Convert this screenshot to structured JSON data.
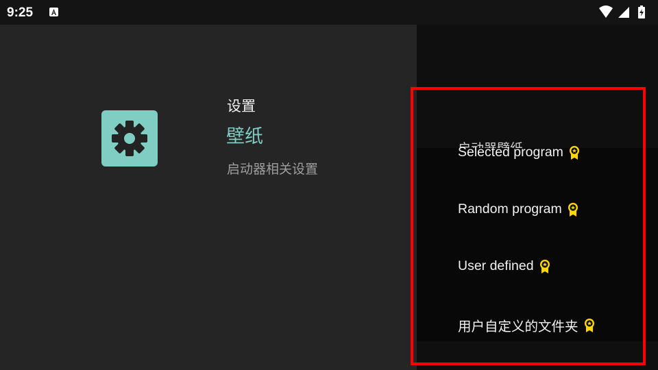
{
  "status_bar": {
    "time": "9:25",
    "notification_icon": "font-a-icon",
    "icons": [
      "wifi-icon",
      "signal-icon",
      "battery-charging-icon"
    ]
  },
  "page": {
    "app_icon": "settings-gear-icon",
    "breadcrumb": "设置",
    "title": "壁纸",
    "description": "启动器相关设置"
  },
  "panel": {
    "title": "启动器壁纸",
    "options": [
      {
        "label": "Selected program",
        "badge": "premium-badge-icon"
      },
      {
        "label": "Random program",
        "badge": "premium-badge-icon"
      },
      {
        "label": "User defined",
        "badge": "premium-badge-icon"
      },
      {
        "label": "用户自定义的文件夹",
        "badge": "premium-badge-icon"
      }
    ]
  },
  "colors": {
    "accent": "#80cbc4",
    "icon_bg": "#7fcdc3",
    "badge": "#ffd600",
    "highlight": "#ff0000",
    "background": "#252525",
    "panel": "#080808"
  }
}
